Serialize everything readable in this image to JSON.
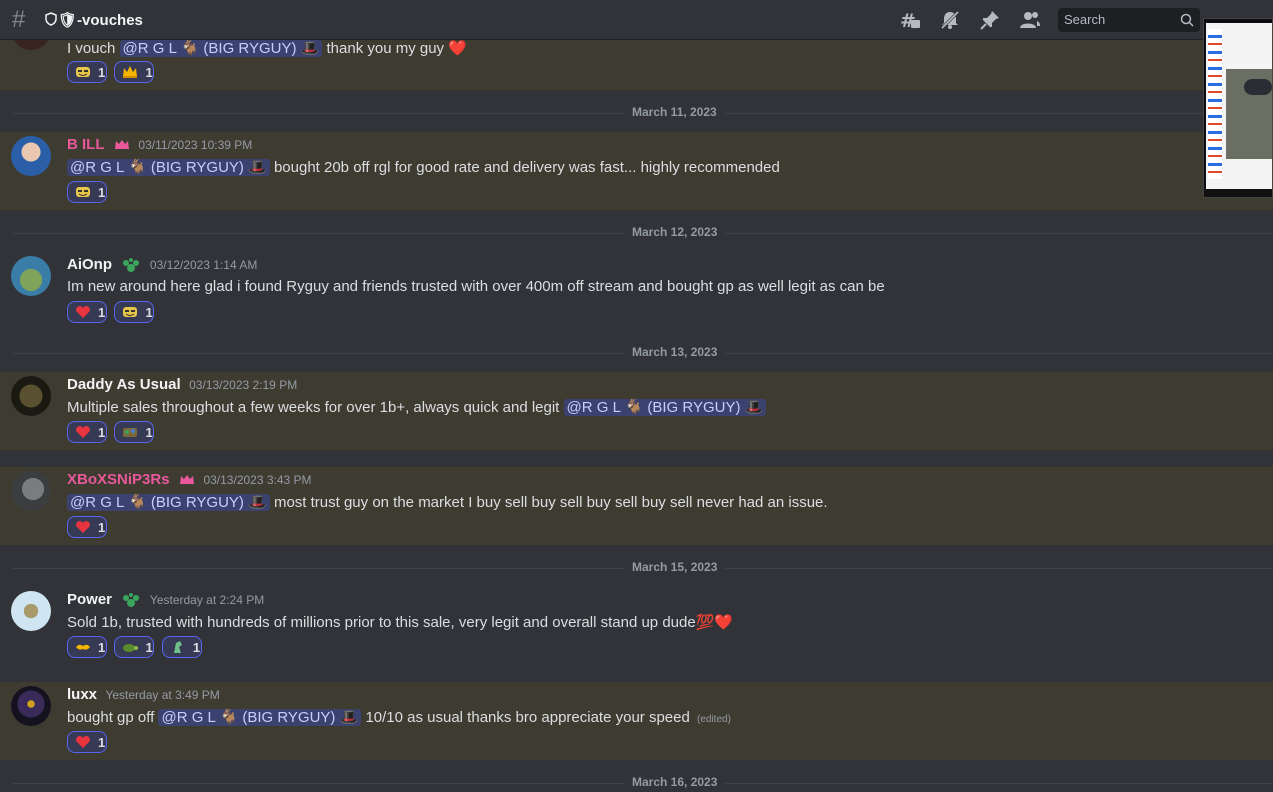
{
  "header": {
    "channel_name": "🛡-vouches",
    "search_placeholder": "Search"
  },
  "messages": [
    {
      "text_before": "I vouch",
      "mention": "@R G L 🐐 (BIG RYGUY) 🎩",
      "text_after": "thank you my guy",
      "trailing_emoji": "❤️",
      "reactions": [
        {
          "emoji": "troll-face-emoji",
          "count": "1"
        },
        {
          "emoji": "crown-emoji",
          "count": "1"
        }
      ]
    },
    {
      "date": "March 11, 2023",
      "username": "B ILL",
      "username_color": "#e9589b",
      "timestamp": "03/11/2023 10:39 PM",
      "mention": "@R G L 🐐 (BIG RYGUY) 🎩",
      "text_after": "bought 20b off rgl for good rate and delivery was fast... highly recommended",
      "reactions": [
        {
          "emoji": "troll-face-emoji",
          "count": "1"
        }
      ]
    },
    {
      "date": "March 12, 2023",
      "username": "AiOnp",
      "timestamp": "03/12/2023 1:14 AM",
      "text": "Im new around here glad i found Ryguy and friends trusted with over 400m off stream and bought gp as well legit as can be",
      "reactions": [
        {
          "emoji": "red-heart-emoji",
          "count": "1"
        },
        {
          "emoji": "troll-face-emoji",
          "count": "1"
        }
      ]
    },
    {
      "date": "March 13, 2023",
      "username": "Daddy As Usual",
      "timestamp": "03/13/2023 2:19 PM",
      "text_before": "Multiple sales throughout a few weeks for over 1b+, always quick and legit",
      "mention": "@R G L 🐐 (BIG RYGUY) 🎩",
      "reactions": [
        {
          "emoji": "red-heart-emoji",
          "count": "1"
        },
        {
          "emoji": "custom-emoji",
          "count": "1"
        }
      ]
    },
    {
      "username": "XBoXSNiP3Rs",
      "username_color": "#e9589b",
      "timestamp": "03/13/2023 3:43 PM",
      "mention": "@R G L 🐐 (BIG RYGUY) 🎩",
      "text_after": "most trust guy on the market I buy sell buy sell buy sell buy sell never had an issue.",
      "reactions": [
        {
          "emoji": "red-heart-emoji",
          "count": "1"
        }
      ]
    },
    {
      "date": "March 15, 2023",
      "username": "Power",
      "timestamp": "Yesterday at 2:24 PM",
      "text": "Sold 1b, trusted with hundreds of millions prior to this sale, very legit and overall stand up dude",
      "trailing_emoji": "💯❤️",
      "reactions": [
        {
          "emoji": "handshake-emoji",
          "count": "1"
        },
        {
          "emoji": "turtle-emoji",
          "count": "1"
        },
        {
          "emoji": "custom-emoji",
          "count": "1"
        }
      ]
    },
    {
      "username": "luxx",
      "timestamp": "Yesterday at 3:49 PM",
      "text_before": "bought gp off",
      "mention": "@R G L 🐐 (BIG RYGUY) 🎩",
      "text_after": "10/10 as usual thanks bro appreciate your speed",
      "edited": "(edited)",
      "reactions": [
        {
          "emoji": "red-heart-emoji",
          "count": "1"
        }
      ]
    },
    {
      "date": "March 16, 2023"
    }
  ]
}
